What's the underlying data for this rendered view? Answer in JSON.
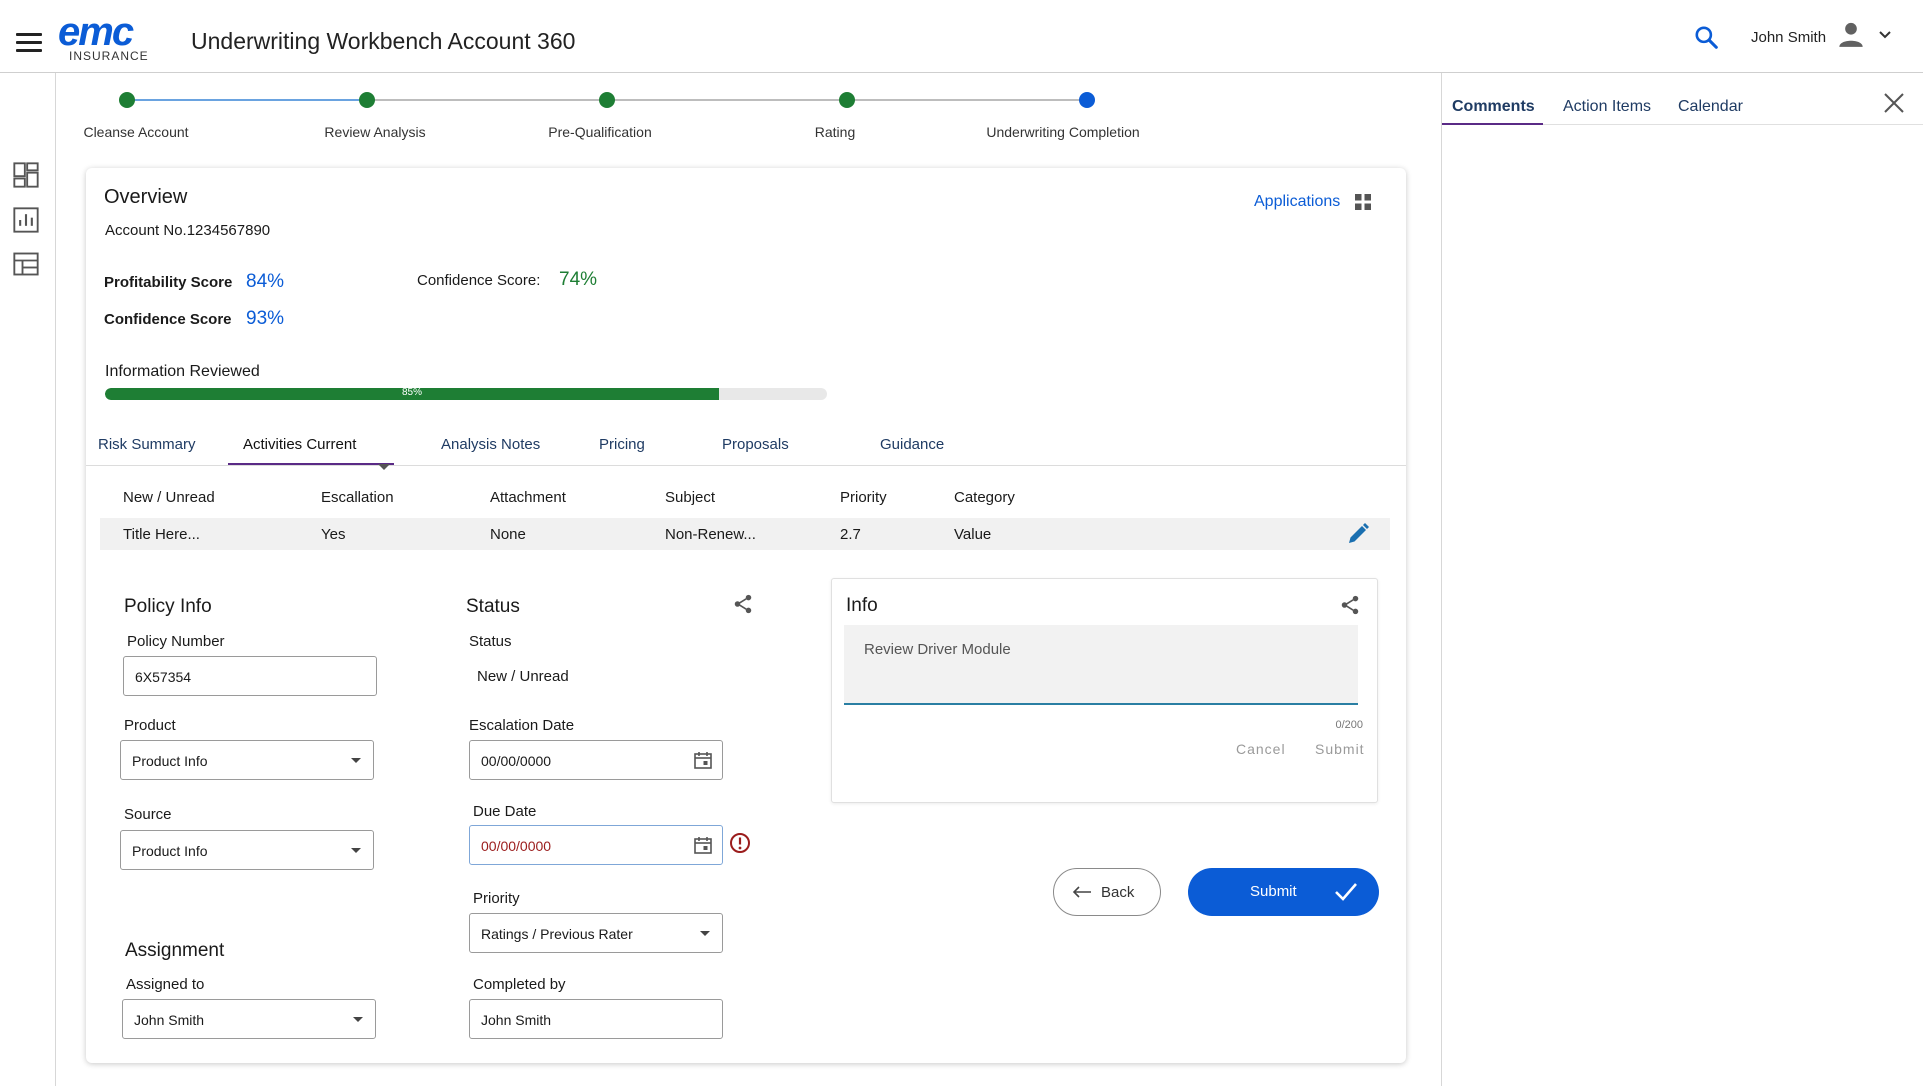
{
  "header": {
    "logo_main": "emc",
    "logo_sub": "INSURANCE",
    "title": "Underwriting Workbench Account 360",
    "user_name": "John Smith"
  },
  "rail": {
    "icons": [
      "dashboard-icon",
      "report-chart-icon",
      "table-layout-icon"
    ]
  },
  "stepper": {
    "steps": [
      {
        "label": "Cleanse Account",
        "state": "complete"
      },
      {
        "label": "Review Analysis",
        "state": "complete"
      },
      {
        "label": "Pre-Qualification",
        "state": "complete"
      },
      {
        "label": "Rating",
        "state": "complete"
      },
      {
        "label": "Underwriting Completion",
        "state": "current"
      }
    ]
  },
  "overview": {
    "title": "Overview",
    "account_no": "Account No.1234567890",
    "applications_label": "Applications",
    "profitability_label": "Profitability Score",
    "profitability_value": "84%",
    "confidence_label": "Confidence Score",
    "confidence_value": "93%",
    "confidence2_label": "Confidence Score:",
    "confidence2_value": "74%",
    "info_reviewed_label": "Information Reviewed",
    "info_reviewed_percent": 85,
    "info_reviewed_text": "85%"
  },
  "tabs": [
    {
      "label": "Risk Summary"
    },
    {
      "label": "Activities Current",
      "active": true
    },
    {
      "label": "Analysis Notes"
    },
    {
      "label": "Pricing"
    },
    {
      "label": "Proposals"
    },
    {
      "label": "Guidance"
    }
  ],
  "table": {
    "headers": [
      "New / Unread",
      "Escallation",
      "Attachment",
      "Subject",
      "Priority",
      "Category"
    ],
    "rows": [
      [
        "Title Here...",
        "Yes",
        "None",
        "Non-Renew...",
        "2.7",
        "Value"
      ]
    ]
  },
  "policy": {
    "title": "Policy Info",
    "policy_number_label": "Policy Number",
    "policy_number_value": "6X57354",
    "product_label": "Product",
    "product_value": "Product Info",
    "source_label": "Source",
    "source_value": "Product Info"
  },
  "assignment": {
    "title": "Assignment",
    "assigned_label": "Assigned to",
    "assigned_value": "John Smith"
  },
  "status": {
    "title": "Status",
    "status_label": "Status",
    "status_value": "New / Unread",
    "escalation_label": "Escalation Date",
    "escalation_value": "00/00/0000",
    "due_label": "Due Date",
    "due_value": "00/00/0000",
    "priority_label": "Priority",
    "priority_value": "Ratings / Previous Rater",
    "completed_label": "Completed by",
    "completed_value": "John Smith"
  },
  "info": {
    "title": "Info",
    "text": "Review Driver Module",
    "char_count": "0/200",
    "cancel_label": "Cancel",
    "submit_label": "Submit"
  },
  "actions": {
    "back_label": "Back",
    "submit_label": "Submit"
  },
  "right_panel": {
    "tabs": [
      {
        "label": "Comments",
        "active": true
      },
      {
        "label": "Action Items"
      },
      {
        "label": "Calendar"
      }
    ]
  },
  "colors": {
    "brand_blue": "#0b5cd6",
    "success_green": "#1e7e34",
    "tab_underline": "#5a2a86",
    "error_red": "#9b1c1c"
  }
}
